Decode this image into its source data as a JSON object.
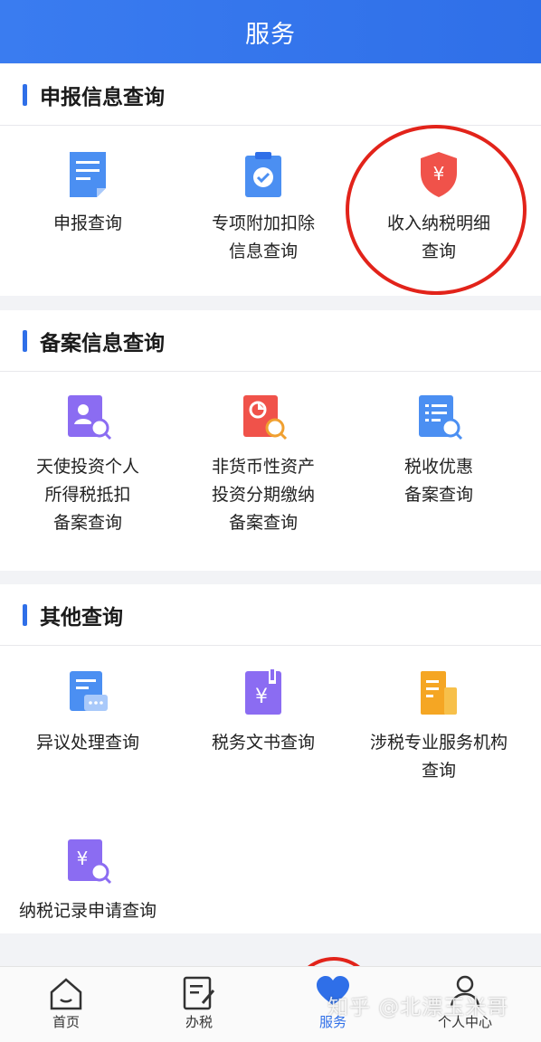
{
  "header": {
    "title": "服务"
  },
  "sections": [
    {
      "title": "申报信息查询",
      "items": [
        {
          "label": "申报查询",
          "icon": "document-icon"
        },
        {
          "label": "专项附加扣除\n信息查询",
          "icon": "clipboard-check-icon"
        },
        {
          "label": "收入纳税明细\n查询",
          "icon": "shield-yuan-icon"
        }
      ]
    },
    {
      "title": "备案信息查询",
      "items": [
        {
          "label": "天使投资个人\n所得税抵扣\n备案查询",
          "icon": "person-search-icon"
        },
        {
          "label": "非货币性资产\n投资分期缴纳\n备案查询",
          "icon": "chart-search-icon"
        },
        {
          "label": "税收优惠\n备案查询",
          "icon": "list-search-icon"
        }
      ]
    },
    {
      "title": "其他查询",
      "items": [
        {
          "label": "异议处理查询",
          "icon": "message-doc-icon"
        },
        {
          "label": "税务文书查询",
          "icon": "yuan-book-icon"
        },
        {
          "label": "涉税专业服务机构\n查询",
          "icon": "building-icon"
        },
        {
          "label": "纳税记录申请查询",
          "icon": "yuan-search-icon"
        }
      ]
    }
  ],
  "tabbar": {
    "items": [
      {
        "label": "首页",
        "icon": "home-icon"
      },
      {
        "label": "办税",
        "icon": "edit-doc-icon"
      },
      {
        "label": "服务",
        "icon": "heart-icon",
        "active": true
      },
      {
        "label": "个人中心",
        "icon": "user-icon"
      }
    ]
  },
  "watermark": "知乎 @北漂玉米哥",
  "colors": {
    "brand": "#2f6fe8",
    "highlight_circle": "#e2231a"
  }
}
